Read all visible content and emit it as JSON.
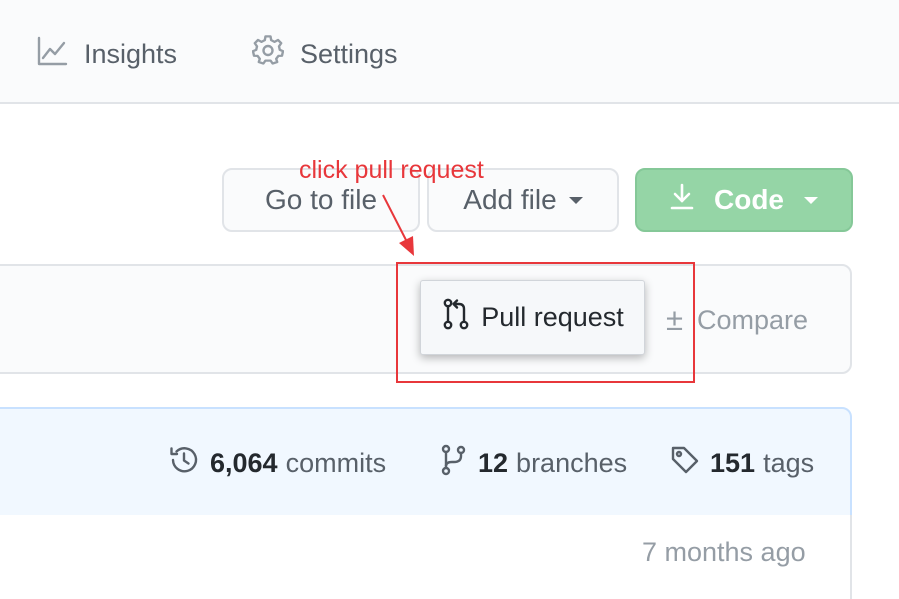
{
  "nav": {
    "items": [
      {
        "label": "Insights",
        "icon": "graph-icon"
      },
      {
        "label": "Settings",
        "icon": "gear-icon"
      }
    ]
  },
  "toolbar": {
    "goto_file_label": "Go to file",
    "add_file_label": "Add file",
    "code_label": "Code"
  },
  "annotation": {
    "text": "click pull request",
    "color": "#e8373b"
  },
  "compare_bar": {
    "pull_request_label": "Pull request",
    "compare_label": "Compare",
    "compare_symbol": "±"
  },
  "stats": {
    "commits": {
      "count": "6,064",
      "label": "commits"
    },
    "branches": {
      "count": "12",
      "label": "branches"
    },
    "tags": {
      "count": "151",
      "label": "tags"
    }
  },
  "file_list": {
    "timestamp": "7 months ago"
  },
  "colors": {
    "code_button": "#95d5a6",
    "stats_background": "#f1f8ff",
    "muted_text": "#586069"
  }
}
